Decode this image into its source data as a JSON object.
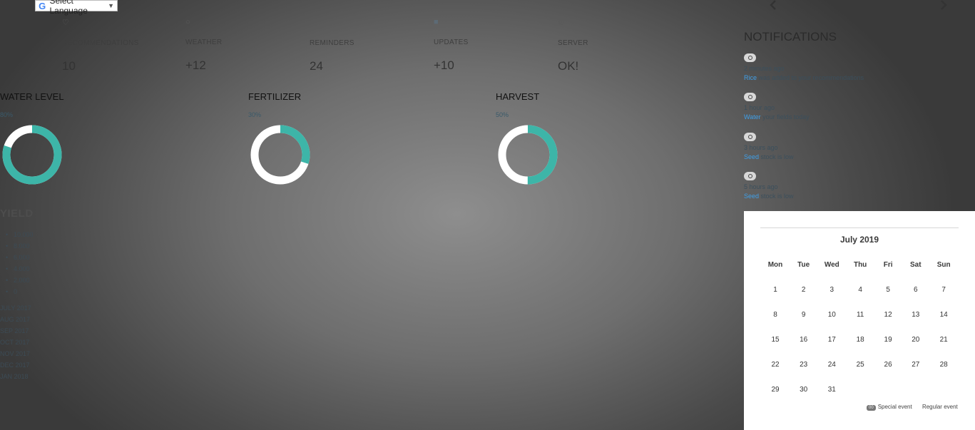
{
  "language_selector": {
    "label": "Select Language",
    "arrow": "▼",
    "icon": "google-g-icon"
  },
  "stats": [
    {
      "icon": "heart-icon",
      "icon_glyph": "♡",
      "label": "RECOMMENDATIONS",
      "value": "10"
    },
    {
      "icon": "drop-icon",
      "icon_glyph": "○",
      "label": "WEATHER",
      "value": "+12"
    },
    {
      "icon": "bell-icon",
      "icon_glyph": "",
      "label": "REMINDERS",
      "value": "24"
    },
    {
      "icon": "square-icon",
      "icon_glyph": "■",
      "label": "UPDATES",
      "value": "+10"
    },
    {
      "icon": "server-icon",
      "icon_glyph": "⚙",
      "label": "SERVER",
      "value": "OK!"
    }
  ],
  "gauges": [
    {
      "title": "WATER LEVEL",
      "percent_label": "80%",
      "fraction": 0.8
    },
    {
      "title": "FERTILIZER",
      "percent_label": "30%",
      "fraction": 0.3
    },
    {
      "title": "HARVEST",
      "percent_label": "50%",
      "fraction": 0.5
    }
  ],
  "yield": {
    "title": "YIELD",
    "values": [
      "10.000",
      "8.000",
      "6.000",
      "4.000",
      "2.000",
      "0"
    ],
    "months": [
      "JULY 2017",
      "AUG 2017",
      "SEP 2017",
      "OCT 2017",
      "NOV 2017",
      "DEC 2017",
      "JAN 2018"
    ]
  },
  "notifications": {
    "title": "NOTIFICATIONS",
    "items": [
      {
        "time": "2 minutes ago",
        "highlight": "Rice",
        "text": " was added to your recommendations"
      },
      {
        "time": "1 hour ago",
        "highlight": "Water",
        "text": " your fields today"
      },
      {
        "time": "3 hours ago",
        "highlight": "Seed",
        "text": " stock is low"
      },
      {
        "time": "5 hours ago",
        "highlight": "Seed",
        "text": " stock is low"
      }
    ]
  },
  "calendar": {
    "month_label": "July 2019",
    "prev": "‹",
    "next": "›",
    "weekdays": [
      "Mon",
      "Tue",
      "Wed",
      "Thu",
      "Fri",
      "Sat",
      "Sun"
    ],
    "weeks": [
      [
        "1",
        "2",
        "3",
        "4",
        "5",
        "6",
        "7"
      ],
      [
        "8",
        "9",
        "10",
        "11",
        "12",
        "13",
        "14"
      ],
      [
        "15",
        "16",
        "17",
        "18",
        "19",
        "20",
        "21"
      ],
      [
        "22",
        "23",
        "24",
        "25",
        "26",
        "27",
        "28"
      ],
      [
        "29",
        "30",
        "31",
        "",
        "",
        "",
        ""
      ]
    ],
    "legend": {
      "badge": "00",
      "special": "Special event",
      "regular": "Regular event"
    }
  },
  "colors": {
    "accent": "#3db5a8",
    "link": "#3f9fe8",
    "donut_track": "#ffffff"
  }
}
